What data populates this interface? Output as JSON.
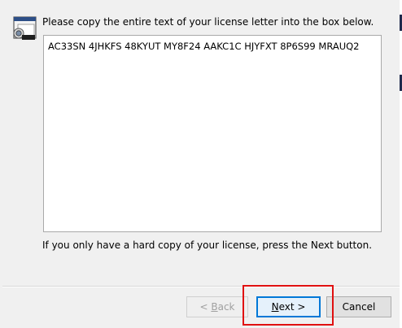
{
  "wizard": {
    "instruction": "Please copy the entire text of your license letter into the box below.",
    "license_text": "AC33SN 4JHKFS 48KYUT MY8F24 AAKC1C HJYFXT 8P6S99 MRAUQ2",
    "hint": "If you only have a hard copy of your license, press the Next button.",
    "icon": "installer-window-icon"
  },
  "buttons": {
    "back": {
      "prefix": "< ",
      "mnemonic": "B",
      "rest": "ack",
      "enabled": false
    },
    "next": {
      "mnemonic": "N",
      "rest": "ext >",
      "focused": true
    },
    "cancel": "Cancel"
  },
  "colors": {
    "highlight": "#e01010",
    "focus_border": "#0078d7"
  }
}
